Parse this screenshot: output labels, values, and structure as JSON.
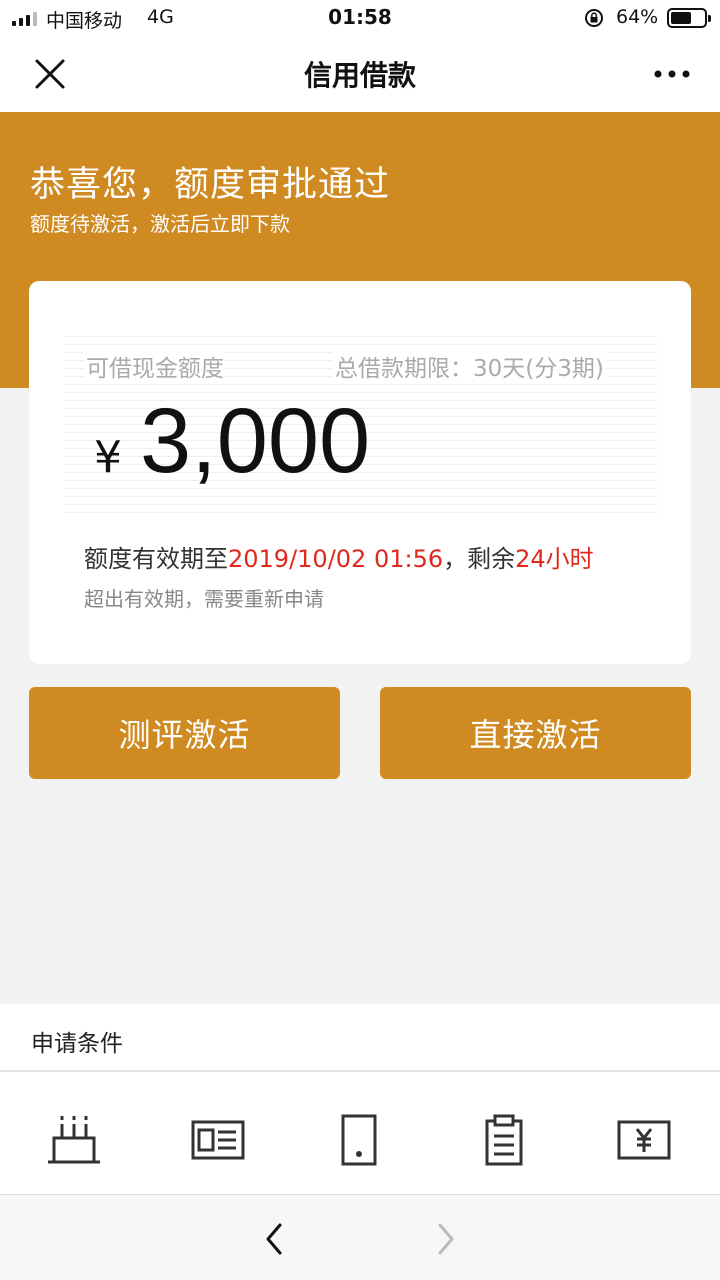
{
  "status_bar": {
    "carrier": "中国移动",
    "network": "4G",
    "time": "01:58",
    "battery": "64%",
    "battery_level": 0.64
  },
  "nav": {
    "title": "信用借款",
    "close_icon": "close-icon",
    "more_icon": "more-icon"
  },
  "hero": {
    "title": "恭喜您，额度审批通过",
    "subtitle": "额度待激活，激活后立即下款"
  },
  "card": {
    "available_label": "可借现金额度",
    "term_label": "总借款期限：30天(分3期)",
    "currency": "¥",
    "amount": "3,000",
    "validity_prefix": "额度有效期至",
    "validity_date": "2019/10/02 01:56",
    "validity_mid": "，剩余",
    "validity_remaining": "24小时",
    "validity_note": "超出有效期，需要重新申请"
  },
  "buttons": {
    "evaluate": "测评激活",
    "direct": "直接激活"
  },
  "conditions": {
    "title": "申请条件",
    "icons": [
      "cake-icon",
      "id-card-icon",
      "phone-icon",
      "clipboard-icon",
      "yuan-card-icon"
    ]
  },
  "colors": {
    "accent": "#d08a22",
    "highlight_red": "#e0281c"
  }
}
